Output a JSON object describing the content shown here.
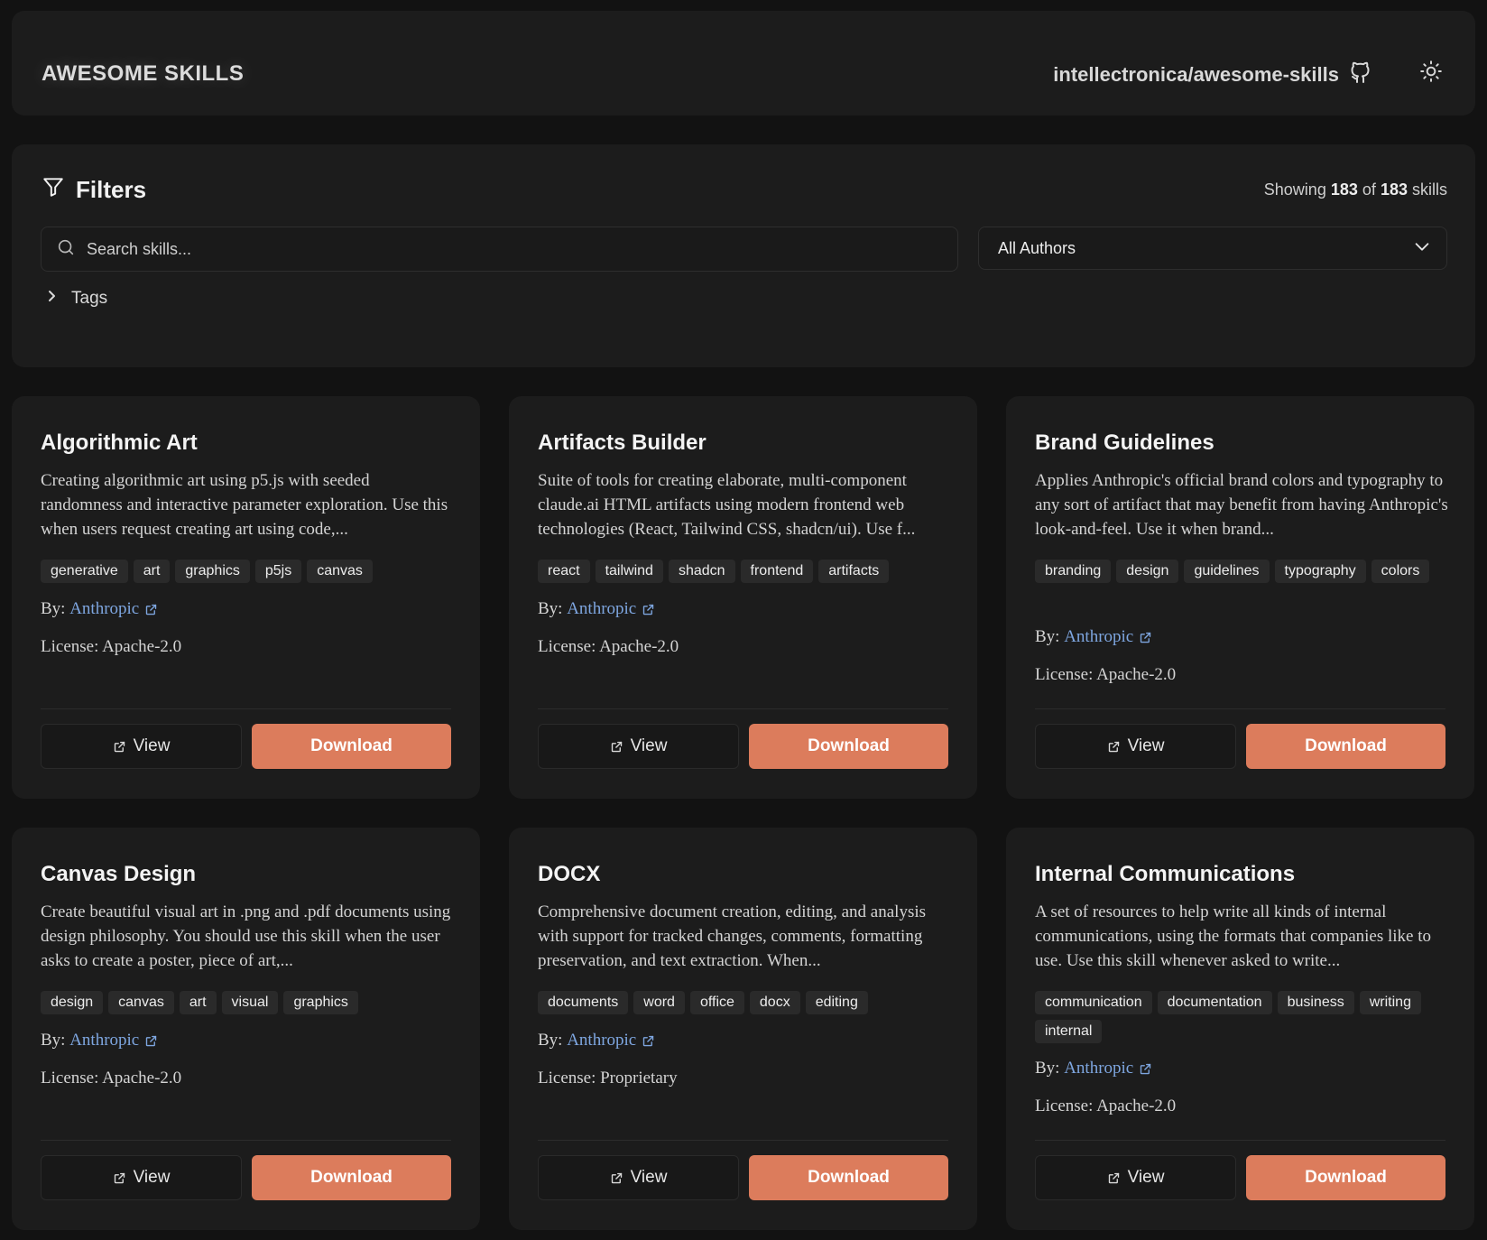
{
  "header": {
    "brand": "AWESOME SKILLS",
    "repo": "intellectronica/awesome-skills"
  },
  "filters": {
    "title": "Filters",
    "showing_prefix": "Showing",
    "showing_count": "183",
    "showing_of": "of",
    "showing_total": "183",
    "showing_suffix": "skills",
    "search_placeholder": "Search skills...",
    "author_selected": "All Authors",
    "tags_label": "Tags"
  },
  "labels": {
    "by": "By:",
    "license": "License:",
    "view": "View",
    "download": "Download"
  },
  "colors": {
    "accent": "#dc7c5c",
    "link": "#7ea6e0",
    "card_bg": "#1c1c1c",
    "page_bg": "#121212"
  },
  "cards": [
    {
      "title": "Algorithmic Art",
      "description": "Creating algorithmic art using p5.js with seeded randomness and interactive parameter exploration. Use this when users request creating art using code,...",
      "tags": [
        "generative",
        "art",
        "graphics",
        "p5js",
        "canvas"
      ],
      "author": "Anthropic",
      "license": "Apache-2.0"
    },
    {
      "title": "Artifacts Builder",
      "description": "Suite of tools for creating elaborate, multi-component claude.ai HTML artifacts using modern frontend web technologies (React, Tailwind CSS, shadcn/ui). Use f...",
      "tags": [
        "react",
        "tailwind",
        "shadcn",
        "frontend",
        "artifacts"
      ],
      "author": "Anthropic",
      "license": "Apache-2.0"
    },
    {
      "title": "Brand Guidelines",
      "description": "Applies Anthropic's official brand colors and typography to any sort of artifact that may benefit from having Anthropic's look-and-feel. Use it when brand...",
      "tags": [
        "branding",
        "design",
        "guidelines",
        "typography",
        "colors"
      ],
      "author": "Anthropic",
      "license": "Apache-2.0"
    },
    {
      "title": "Canvas Design",
      "description": "Create beautiful visual art in .png and .pdf documents using design philosophy. You should use this skill when the user asks to create a poster, piece of art,...",
      "tags": [
        "design",
        "canvas",
        "art",
        "visual",
        "graphics"
      ],
      "author": "Anthropic",
      "license": "Apache-2.0"
    },
    {
      "title": "DOCX",
      "description": "Comprehensive document creation, editing, and analysis with support for tracked changes, comments, formatting preservation, and text extraction. When...",
      "tags": [
        "documents",
        "word",
        "office",
        "docx",
        "editing"
      ],
      "author": "Anthropic",
      "license": "Proprietary"
    },
    {
      "title": "Internal Communications",
      "description": "A set of resources to help write all kinds of internal communications, using the formats that companies like to use. Use this skill whenever asked to write...",
      "tags": [
        "communication",
        "documentation",
        "business",
        "writing",
        "internal"
      ],
      "author": "Anthropic",
      "license": "Apache-2.0"
    }
  ]
}
